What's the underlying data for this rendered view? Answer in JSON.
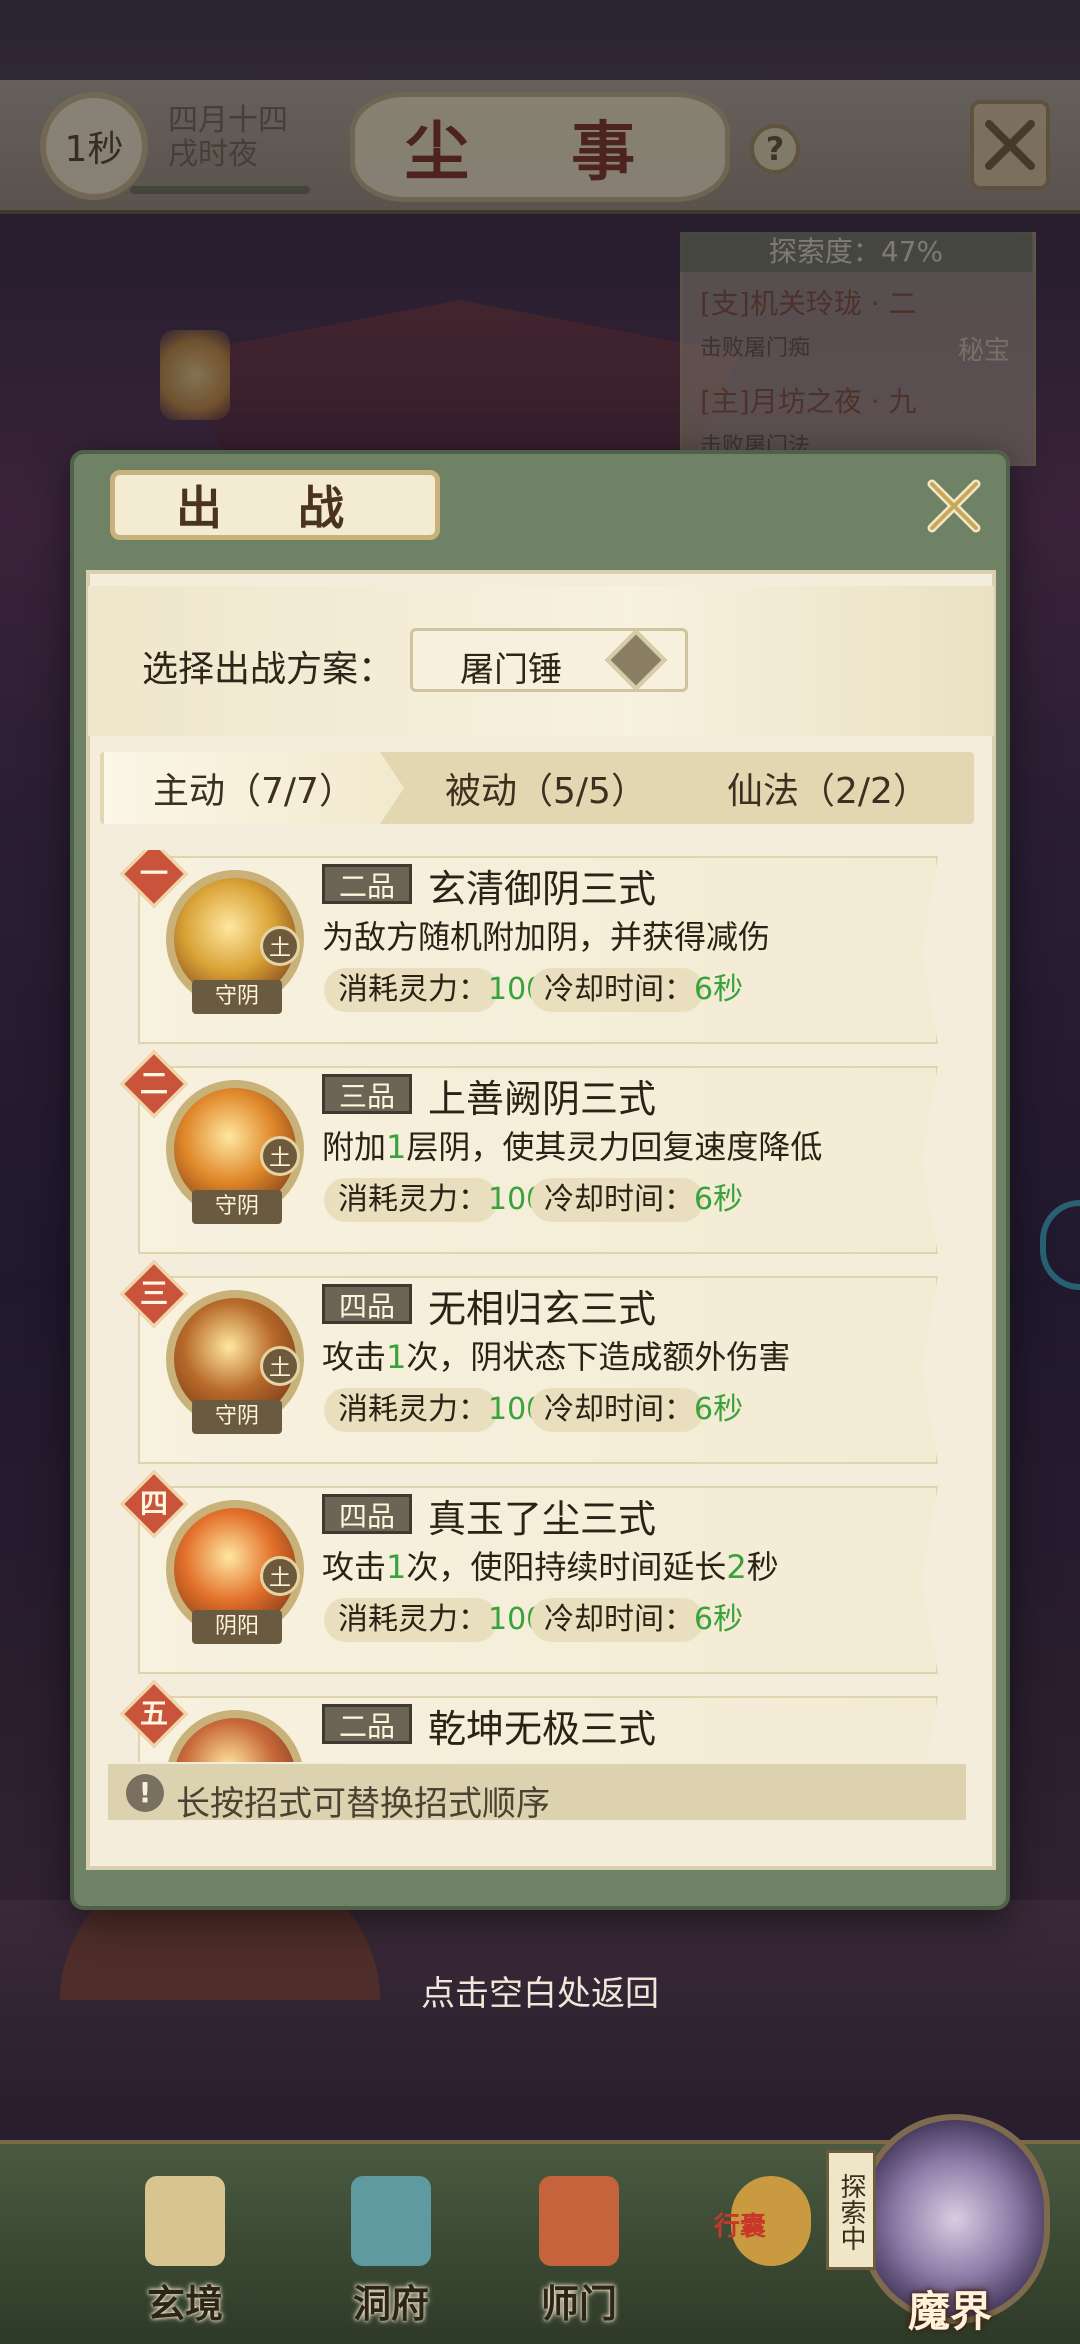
{
  "status_bar": {
    "timer": "1秒",
    "date_line1": "四月十四",
    "date_line2": "戌时夜",
    "title": "尘 事",
    "help": "?"
  },
  "quest_panel": {
    "explore_label": "探索度：47%",
    "items": [
      {
        "title": "[支]机关玲珑 · 二",
        "sub": "击败屠门痴"
      },
      {
        "title": "[主]月坊之夜 · 九",
        "sub": "击败屠门法"
      }
    ],
    "secret_tag": "秘宝"
  },
  "dialog": {
    "title": "出 战",
    "scheme_label": "选择出战方案：",
    "scheme_value": "屠门锤",
    "tabs": [
      {
        "label": "主动（7/7）",
        "active": true
      },
      {
        "label": "被动（5/5）",
        "active": false
      },
      {
        "label": "仙法（2/2）",
        "active": false
      }
    ],
    "skills": [
      {
        "num": "一",
        "grade": "二品",
        "name": "玄清御阴三式",
        "tag": "守阴",
        "element": "土",
        "desc_parts": [
          "为敌方随机附加阴，并获得减伤"
        ],
        "cost_label": "消耗灵力：",
        "cost_value": "100",
        "cd_label": "冷却时间：",
        "cd_value": "6秒",
        "icon_color": "#d9a236"
      },
      {
        "num": "二",
        "grade": "三品",
        "name": "上善阙阴三式",
        "tag": "守阴",
        "element": "土",
        "desc_parts": [
          "附加",
          "1",
          "层阴，使其灵力回复速度降低"
        ],
        "cost_label": "消耗灵力：",
        "cost_value": "100",
        "cd_label": "冷却时间：",
        "cd_value": "6秒",
        "icon_color": "#e0882a"
      },
      {
        "num": "三",
        "grade": "四品",
        "name": "无相归玄三式",
        "tag": "守阴",
        "element": "土",
        "desc_parts": [
          "攻击",
          "1",
          "次，阴状态下造成额外伤害"
        ],
        "cost_label": "消耗灵力：",
        "cost_value": "100",
        "cd_label": "冷却时间：",
        "cd_value": "6秒",
        "icon_color": "#b86a2a"
      },
      {
        "num": "四",
        "grade": "四品",
        "name": "真玉了尘三式",
        "tag": "阴阳",
        "element": "土",
        "desc_parts": [
          "攻击",
          "1",
          "次，使阳持续时间延长",
          "2",
          "秒"
        ],
        "cost_label": "消耗灵力：",
        "cost_value": "100",
        "cd_label": "冷却时间：",
        "cd_value": "6秒",
        "icon_color": "#e2702a"
      },
      {
        "num": "五",
        "grade": "二品",
        "name": "乾坤无极三式",
        "tag": "",
        "element": "",
        "desc_parts": [
          ""
        ],
        "cost_label": "",
        "cost_value": "",
        "cd_label": "",
        "cd_value": "",
        "icon_color": "#c86a3a"
      }
    ],
    "hint": "长按招式可替换招式顺序",
    "hint_icon": "!"
  },
  "return_hint": "点击空白处返回",
  "bottom_nav": {
    "items": [
      {
        "label": "玄境",
        "color": "#d8c48e"
      },
      {
        "label": "洞府",
        "color": "#5f9aa0"
      },
      {
        "label": "师门",
        "color": "#c4633c"
      },
      {
        "label": "",
        "color": "#c99a40"
      }
    ],
    "bag_badge": "行囊",
    "explore_badge": "探索中",
    "demon_realm": "魔界"
  },
  "colors": {
    "accent_green": "#3aa23a",
    "dialog_frame": "#6f8266",
    "skill_number_red": "#c9533b"
  },
  "icons": [
    "close-icon",
    "help-icon",
    "diamond-dropdown-icon",
    "exclamation-icon"
  ]
}
